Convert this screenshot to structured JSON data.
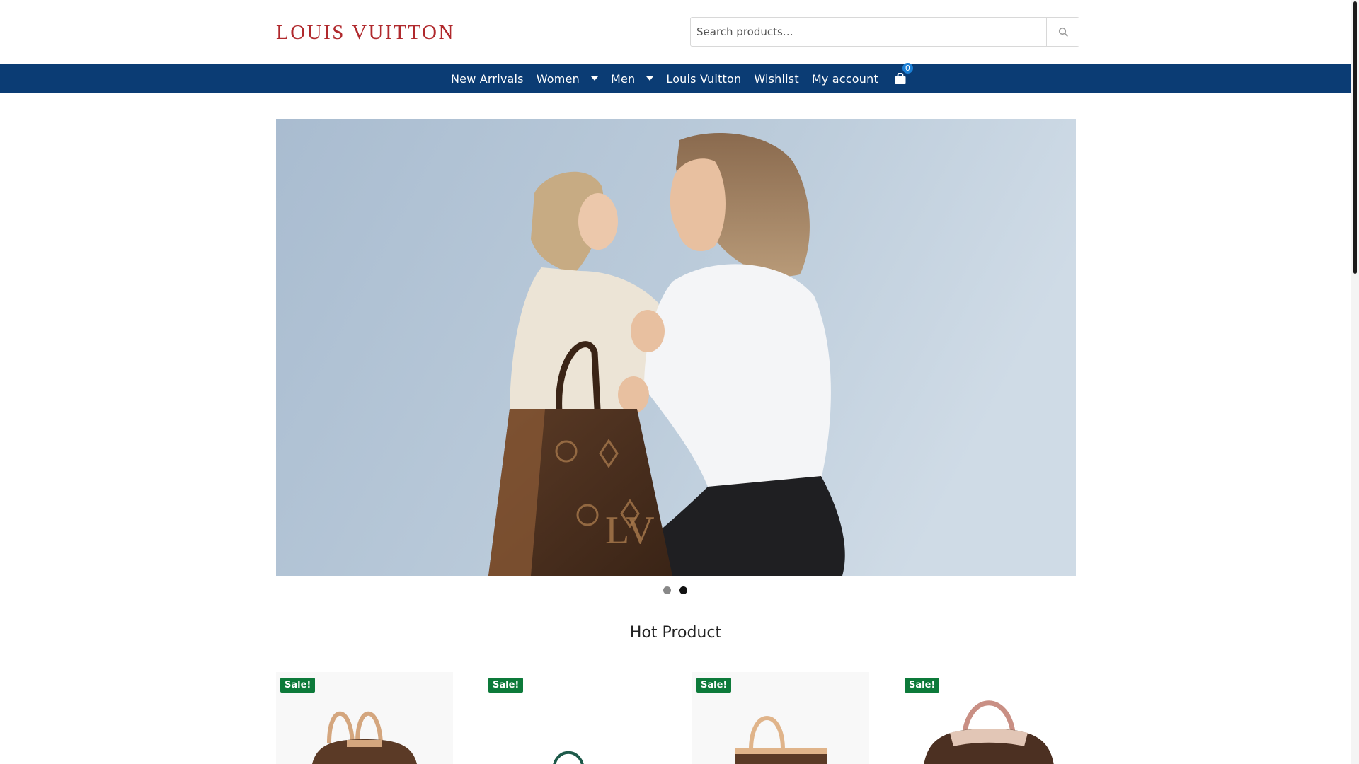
{
  "header": {
    "logo_text": "LOUIS VUITTON",
    "search": {
      "placeholder": "Search products…",
      "icon": "search-icon"
    }
  },
  "nav": {
    "items": [
      {
        "label": "New Arrivals"
      },
      {
        "label": "Women",
        "dropdown": true
      },
      {
        "label": "Men",
        "dropdown": true
      },
      {
        "label": "Louis Vuitton"
      },
      {
        "label": "Wishlist"
      },
      {
        "label": "My account"
      }
    ],
    "cart": {
      "icon": "shopping-bag-icon",
      "count": "0"
    }
  },
  "slider": {
    "total_slides": 2,
    "active_slide": 2
  },
  "section": {
    "title": "Hot Product"
  },
  "products": [
    {
      "badge": "Sale!"
    },
    {
      "badge": "Sale!"
    },
    {
      "badge": "Sale!"
    },
    {
      "badge": "Sale!"
    }
  ],
  "colors": {
    "nav_bg": "#0b3c74",
    "logo": "#b0292d",
    "sale_badge": "#0d7a3a",
    "cart_badge": "#1a7fd6"
  }
}
